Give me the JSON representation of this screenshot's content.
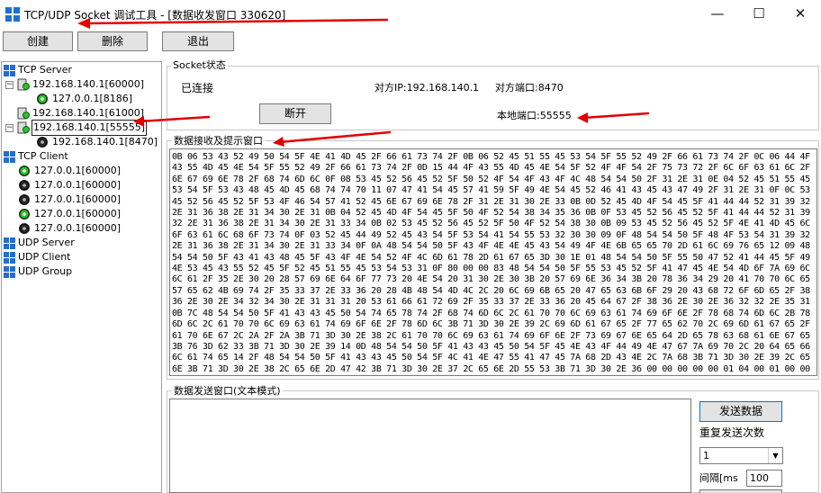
{
  "window": {
    "title": "TCP/UDP Socket 调试工具 - [数据收发窗口 330620]",
    "minimize": "—",
    "maximize": "☐",
    "close": "✕"
  },
  "toolbar": {
    "create_label": "创建",
    "delete_label": "删除",
    "exit_label": "退出"
  },
  "tree": {
    "tcp_server": "TCP Server",
    "servers": [
      {
        "label": "192.168.140.1[60000]",
        "child": "127.0.0.1[8186]"
      },
      {
        "label": "192.168.140.1[61000]"
      },
      {
        "label": "192.168.140.1[55555]",
        "child": "192.168.140.1[8470]"
      }
    ],
    "tcp_client": "TCP Client",
    "clients": [
      "127.0.0.1[60000]",
      "127.0.0.1[60000]",
      "127.0.0.1[60000]",
      "127.0.0.1[60000]",
      "127.0.0.1[60000]"
    ],
    "udp_server": "UDP Server",
    "udp_client": "UDP Client",
    "udp_group": "UDP Group"
  },
  "socket_status": {
    "legend": "Socket状态",
    "state": "已连接",
    "peer_ip": "对方IP:192.168.140.1",
    "peer_port": "对方端口:8470",
    "disconnect_label": "断开",
    "local_port": "本地端口:55555"
  },
  "receive": {
    "legend": "数据接收及提示窗口",
    "content": "0B 06 53 43 52 49 50 54 5F 4E 41 4D 45 2F 66 61 73 74 2F 0B 06 52 45 51 55 45 53 54 5F 55 52 49 2F 66 61 73 74 2F 0C 06 44 4F 43 55 4D 45 4E 54 5F 55 52 49 2F 66 61 73 74 2F 0D 15 44 4F 43 55 4D 45 4E 54 5F 52 4F 4F 54 2F 75 73 72 2F 6C 6F 63 61 6C 2F 6E 67 69 6E 78 2F 68 74 6D 6C 0F 08 53 45 52 56 45 52 5F 50 52 4F 54 4F 43 4F 4C 48 54 54 50 2F 31 2E 31 0E 04 52 45 51 55 45 53 54 5F 53 43 48 45 4D 45 68 74 74 70 11 07 47 41 54 45 57 41 59 5F 49 4E 54 45 52 46 41 43 45 43 47 49 2F 31 2E 31 0F 0C 53 45 52 56 45 52 5F 53 4F 46 54 57 41 52 45 6E 67 69 6E 78 2F 31 2E 31 30 2E 33 0B 0D 52 45 4D 4F 54 45 5F 41 44 44 52 31 39 32 2E 31 36 38 2E 31 34 30 2E 31 0B 04 52 45 4D 4F 54 45 5F 50 4F 52 54 38 34 35 36 0B 0F 53 45 52 56 45 52 5F 41 44 44 52 31 39 32 2E 31 36 38 2E 31 34 30 2E 31 33 34 0B 02 53 45 52 56 45 52 5F 50 4F 52 54 38 30 0B 09 53 45 52 56 45 52 5F 4E 41 4D 45 6C 6F 63 61 6C 68 6F 73 74 0F 03 52 45 44 49 52 45 43 54 5F 53 54 41 54 55 53 32 30 30 09 0F 48 54 54 50 5F 48 4F 53 54 31 39 32 2E 31 36 38 2E 31 34 30 2E 31 33 34 0F 0A 48 54 54 50 5F 43 4F 4E 4E 45 43 54 49 4F 4E 6B 65 65 70 2D 61 6C 69 76 65 12 09 48 54 54 50 5F 43 41 43 48 45 5F 43 4F 4E 54 52 4F 4C 6D 61 78 2D 61 67 65 3D 30 1E 01 48 54 54 50 5F 55 50 47 52 41 44 45 5F 49 4E 53 45 43 55 52 45 5F 52 45 51 55 45 53 54 53 31 0F 80 00 00 83 48 54 54 50 5F 55 53 45 52 5F 41 47 45 4E 54 4D 6F 7A 69 6C 6C 61 2F 35 2E 30 20 28 57 69 6E 64 6F 77 73 20 4E 54 20 31 30 2E 30 3B 20 57 69 6E 36 34 3B 20 78 36 34 29 20 41 70 70 6C 65 57 65 62 4B 69 74 2F 35 33 37 2E 33 36 20 28 4B 48 54 4D 4C 2C 20 6C 69 6B 65 20 47 65 63 6B 6F 29 20 43 68 72 6F 6D 65 2F 38 36 2E 30 2E 34 32 34 30 2E 31 31 31 20 53 61 66 61 72 69 2F 35 33 37 2E 33 36 20 45 64 67 2F 38 36 2E 30 2E 36 32 32 2E 35 31 0B 7C 48 54 54 50 5F 41 43 43 45 50 54 74 65 78 74 2F 68 74 6D 6C 2C 61 70 70 6C 69 63 61 74 69 6F 6E 2F 78 68 74 6D 6C 2B 78 6D 6C 2C 61 70 70 6C 69 63 61 74 69 6F 6E 2F 78 6D 6C 3B 71 3D 30 2E 39 2C 69 6D 61 67 65 2F 77 65 62 70 2C 69 6D 61 67 65 2F 61 70 6E 67 2C 2A 2F 2A 3B 71 3D 30 2E 38 2C 61 70 70 6C 69 63 61 74 69 6F 6E 2F 73 69 67 6E 65 64 2D 65 78 63 68 61 6E 67 65 3B 76 3D 62 33 3B 71 3D 30 2E 39 14 0D 48 54 54 50 5F 41 43 43 45 50 54 5F 45 4E 43 4F 44 49 4E 47 67 7A 69 70 2C 20 64 65 66 6C 61 74 65 14 2F 48 54 54 50 5F 41 43 43 45 50 54 5F 4C 41 4E 47 55 41 47 45 7A 68 2D 43 4E 2C 7A 68 3B 71 3D 30 2E 39 2C 65 6E 3B 71 3D 30 2E 38 2C 65 6E 2D 47 42 3B 71 3D 30 2E 37 2C 65 6E 2D 55 53 3B 71 3D 30 2E 36 00 00 00 00 00 01 04 00 01 00 00 00 00 01 05 00 01 00 00 00 00 00 }"
  },
  "send": {
    "legend": "数据发送窗口(文本模式)",
    "send_label": "发送数据",
    "repeat_label": "重复发送次数",
    "repeat_value": "1",
    "interval_label": "间隔[ms",
    "interval_value": "100"
  },
  "annotation_color": "#e00000"
}
